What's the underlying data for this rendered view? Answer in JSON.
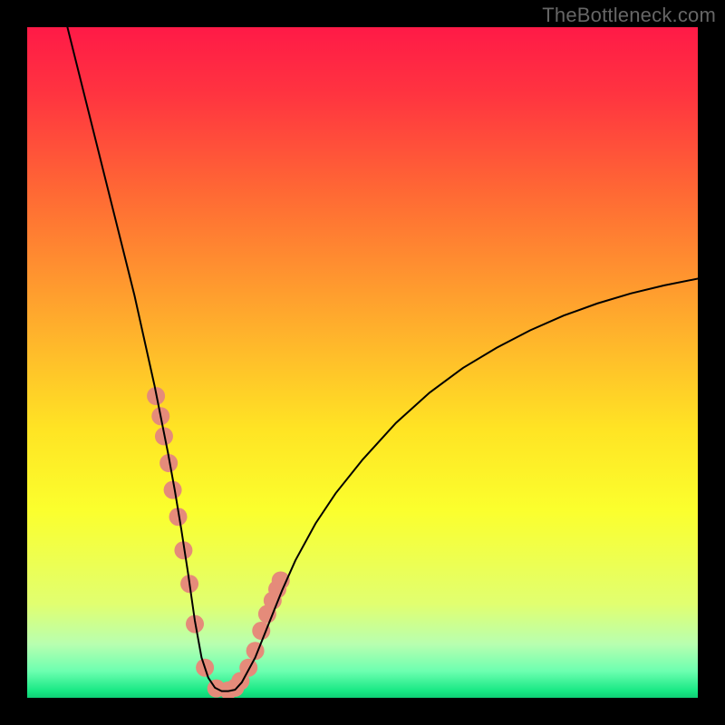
{
  "watermark": "TheBottleneck.com",
  "chart_data": {
    "type": "line",
    "title": "",
    "xlabel": "",
    "ylabel": "",
    "xlim": [
      0,
      100
    ],
    "ylim": [
      0,
      100
    ],
    "grid": false,
    "legend": false,
    "background_gradient": {
      "direction": "vertical",
      "stops": [
        {
          "pos": 0.0,
          "color": "#ff1a47"
        },
        {
          "pos": 0.1,
          "color": "#ff3440"
        },
        {
          "pos": 0.25,
          "color": "#ff6a34"
        },
        {
          "pos": 0.45,
          "color": "#ffb02c"
        },
        {
          "pos": 0.6,
          "color": "#ffe424"
        },
        {
          "pos": 0.72,
          "color": "#fbff2d"
        },
        {
          "pos": 0.86,
          "color": "#e1ff70"
        },
        {
          "pos": 0.92,
          "color": "#b8ffb0"
        },
        {
          "pos": 0.96,
          "color": "#6dffb0"
        },
        {
          "pos": 0.99,
          "color": "#17e884"
        },
        {
          "pos": 1.0,
          "color": "#0fcf75"
        }
      ]
    },
    "series": [
      {
        "name": "bottleneck-curve",
        "color": "#000000",
        "x": [
          6,
          8,
          10,
          12,
          14,
          16,
          18,
          19,
          20,
          21,
          22,
          23,
          24,
          25,
          26,
          27,
          28,
          29,
          30,
          31,
          32,
          34,
          36,
          38,
          40,
          43,
          46,
          50,
          55,
          60,
          65,
          70,
          75,
          80,
          85,
          90,
          95,
          100
        ],
        "y": [
          100,
          92,
          84,
          76,
          68,
          60,
          51,
          46.5,
          41.5,
          36.5,
          31,
          25,
          18.5,
          11.5,
          6,
          3,
          1.5,
          1,
          1,
          1.2,
          2.3,
          6,
          11,
          16,
          20.5,
          26,
          30.5,
          35.5,
          41,
          45.5,
          49.2,
          52.2,
          54.8,
          57,
          58.8,
          60.3,
          61.5,
          62.5
        ]
      }
    ],
    "points": {
      "name": "highlighted-region",
      "color": "#e58b7a",
      "radius_px": 10,
      "x": [
        19.2,
        19.9,
        20.4,
        21.1,
        21.7,
        22.5,
        23.3,
        24.2,
        25.0,
        26.5,
        28.2,
        30.0,
        31.0,
        31.8,
        33.0,
        34.0,
        34.9,
        35.8,
        36.6,
        37.3,
        37.8
      ],
      "y": [
        45,
        42,
        39,
        35,
        31,
        27,
        22,
        17,
        11,
        4.5,
        1.4,
        1.1,
        1.5,
        2.5,
        4.5,
        7,
        10,
        12.5,
        14.5,
        16.2,
        17.5
      ]
    }
  }
}
